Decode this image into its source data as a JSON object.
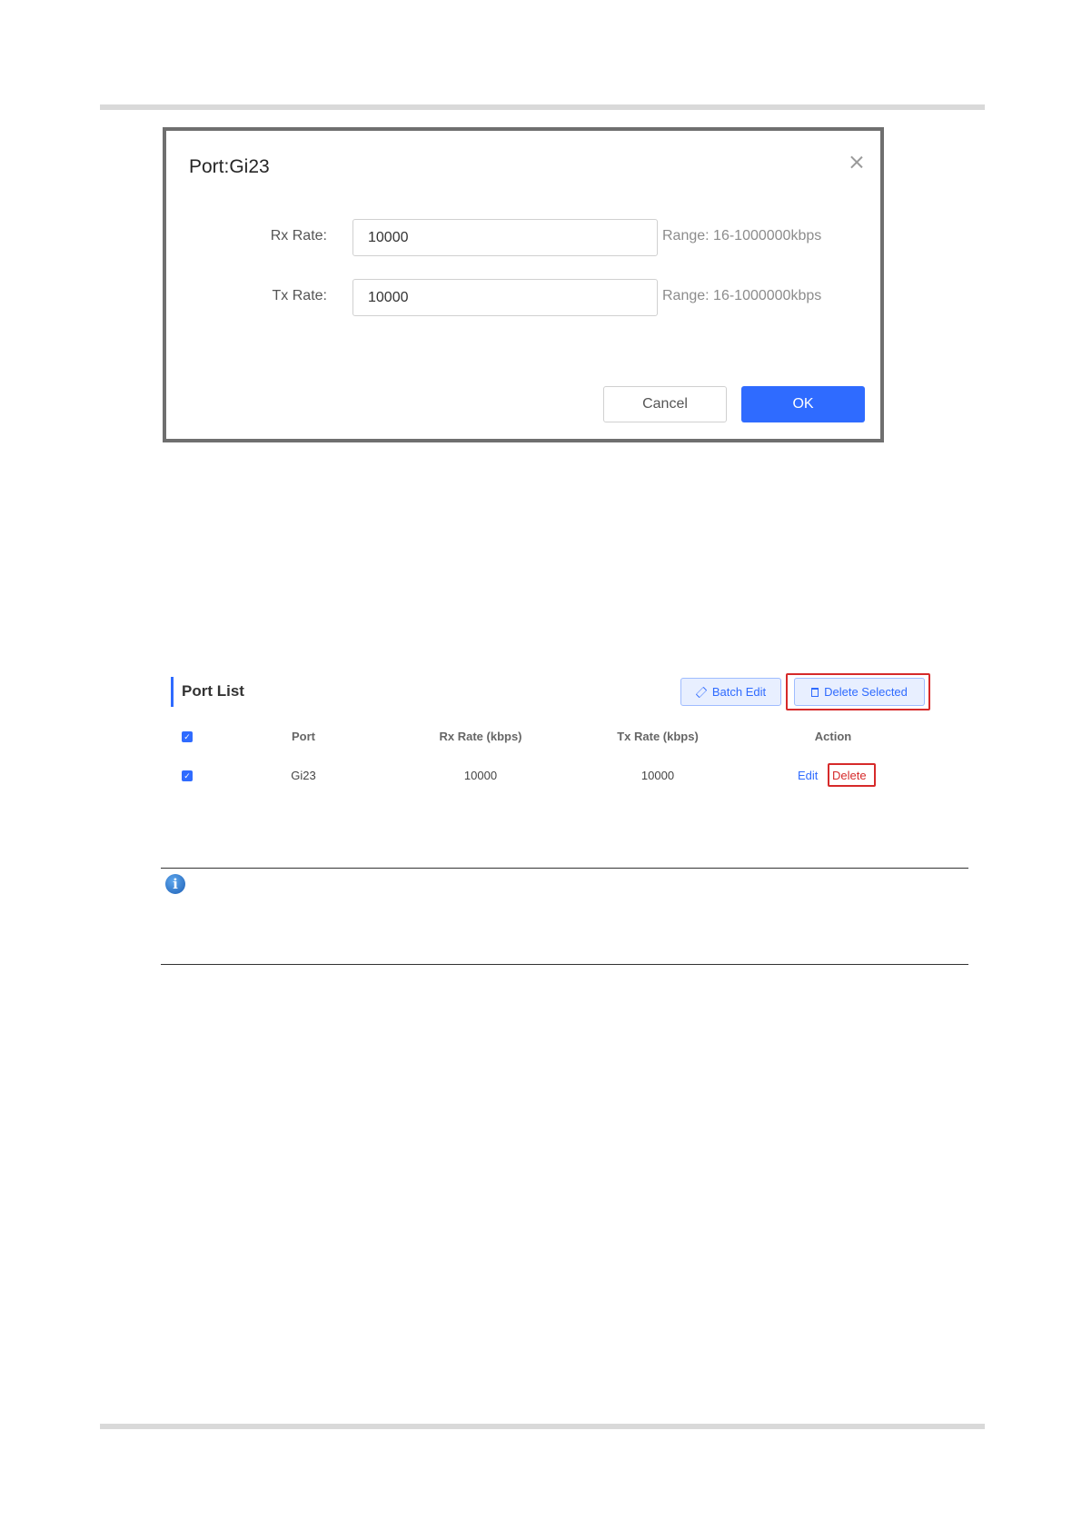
{
  "dialog": {
    "title": "Port:Gi23",
    "close_glyph": "×",
    "fields": [
      {
        "label": "Rx Rate:",
        "value": "10000",
        "range": "Range: 16-1000000kbps"
      },
      {
        "label": "Tx Rate:",
        "value": "10000",
        "range": "Range: 16-1000000kbps"
      }
    ],
    "cancel_label": "Cancel",
    "ok_label": "OK"
  },
  "port_list": {
    "title": "Port List",
    "batch_edit_label": "Batch Edit",
    "delete_selected_label": "Delete Selected",
    "columns": [
      "Port",
      "Rx Rate (kbps)",
      "Tx Rate (kbps)",
      "Action"
    ],
    "rows": [
      {
        "checked": true,
        "port": "Gi23",
        "rx": "10000",
        "tx": "10000",
        "edit": "Edit",
        "delete": "Delete"
      }
    ],
    "header_checked": true
  },
  "note": {
    "icon": "info-icon",
    "icon_glyph": "i"
  },
  "colors": {
    "accent": "#2f6bff",
    "highlight": "#d62a2a"
  }
}
